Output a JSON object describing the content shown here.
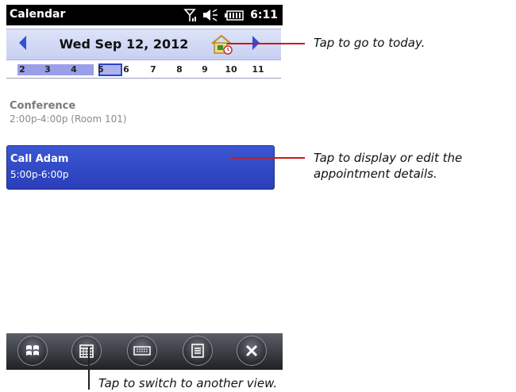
{
  "statusbar": {
    "app_title": "Calendar",
    "time": "6:11"
  },
  "datebar": {
    "date": "Wed Sep 12, 2012"
  },
  "days": [
    "2",
    "3",
    "4",
    "5",
    "6",
    "7",
    "8",
    "9",
    "10",
    "11"
  ],
  "appointments": [
    {
      "title": "Conference",
      "time": "2:00p-4:00p (Room 101)"
    },
    {
      "title": "Call Adam",
      "time": "5:00p-6:00p"
    }
  ],
  "softkeys": [
    "windows-start-icon",
    "calendar-view-icon",
    "keyboard-icon",
    "menu-icon",
    "close-icon"
  ],
  "callouts": {
    "today": "Tap to go to today.",
    "appointment": "Tap to display or edit the appointment details.",
    "switch_view": "Tap to switch to another view."
  },
  "colors": {
    "accent": "#2e52d8",
    "selected_appt": "#3047c4",
    "callout_line": "#d01818"
  }
}
